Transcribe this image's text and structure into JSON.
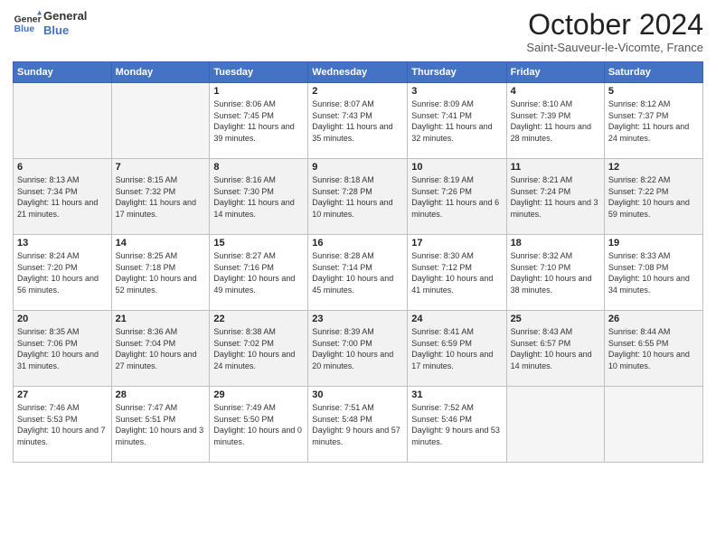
{
  "header": {
    "logo_line1": "General",
    "logo_line2": "Blue",
    "month": "October 2024",
    "location": "Saint-Sauveur-le-Vicomte, France"
  },
  "weekdays": [
    "Sunday",
    "Monday",
    "Tuesday",
    "Wednesday",
    "Thursday",
    "Friday",
    "Saturday"
  ],
  "weeks": [
    [
      {
        "day": "",
        "info": ""
      },
      {
        "day": "",
        "info": ""
      },
      {
        "day": "1",
        "info": "Sunrise: 8:06 AM\nSunset: 7:45 PM\nDaylight: 11 hours and 39 minutes."
      },
      {
        "day": "2",
        "info": "Sunrise: 8:07 AM\nSunset: 7:43 PM\nDaylight: 11 hours and 35 minutes."
      },
      {
        "day": "3",
        "info": "Sunrise: 8:09 AM\nSunset: 7:41 PM\nDaylight: 11 hours and 32 minutes."
      },
      {
        "day": "4",
        "info": "Sunrise: 8:10 AM\nSunset: 7:39 PM\nDaylight: 11 hours and 28 minutes."
      },
      {
        "day": "5",
        "info": "Sunrise: 8:12 AM\nSunset: 7:37 PM\nDaylight: 11 hours and 24 minutes."
      }
    ],
    [
      {
        "day": "6",
        "info": "Sunrise: 8:13 AM\nSunset: 7:34 PM\nDaylight: 11 hours and 21 minutes."
      },
      {
        "day": "7",
        "info": "Sunrise: 8:15 AM\nSunset: 7:32 PM\nDaylight: 11 hours and 17 minutes."
      },
      {
        "day": "8",
        "info": "Sunrise: 8:16 AM\nSunset: 7:30 PM\nDaylight: 11 hours and 14 minutes."
      },
      {
        "day": "9",
        "info": "Sunrise: 8:18 AM\nSunset: 7:28 PM\nDaylight: 11 hours and 10 minutes."
      },
      {
        "day": "10",
        "info": "Sunrise: 8:19 AM\nSunset: 7:26 PM\nDaylight: 11 hours and 6 minutes."
      },
      {
        "day": "11",
        "info": "Sunrise: 8:21 AM\nSunset: 7:24 PM\nDaylight: 11 hours and 3 minutes."
      },
      {
        "day": "12",
        "info": "Sunrise: 8:22 AM\nSunset: 7:22 PM\nDaylight: 10 hours and 59 minutes."
      }
    ],
    [
      {
        "day": "13",
        "info": "Sunrise: 8:24 AM\nSunset: 7:20 PM\nDaylight: 10 hours and 56 minutes."
      },
      {
        "day": "14",
        "info": "Sunrise: 8:25 AM\nSunset: 7:18 PM\nDaylight: 10 hours and 52 minutes."
      },
      {
        "day": "15",
        "info": "Sunrise: 8:27 AM\nSunset: 7:16 PM\nDaylight: 10 hours and 49 minutes."
      },
      {
        "day": "16",
        "info": "Sunrise: 8:28 AM\nSunset: 7:14 PM\nDaylight: 10 hours and 45 minutes."
      },
      {
        "day": "17",
        "info": "Sunrise: 8:30 AM\nSunset: 7:12 PM\nDaylight: 10 hours and 41 minutes."
      },
      {
        "day": "18",
        "info": "Sunrise: 8:32 AM\nSunset: 7:10 PM\nDaylight: 10 hours and 38 minutes."
      },
      {
        "day": "19",
        "info": "Sunrise: 8:33 AM\nSunset: 7:08 PM\nDaylight: 10 hours and 34 minutes."
      }
    ],
    [
      {
        "day": "20",
        "info": "Sunrise: 8:35 AM\nSunset: 7:06 PM\nDaylight: 10 hours and 31 minutes."
      },
      {
        "day": "21",
        "info": "Sunrise: 8:36 AM\nSunset: 7:04 PM\nDaylight: 10 hours and 27 minutes."
      },
      {
        "day": "22",
        "info": "Sunrise: 8:38 AM\nSunset: 7:02 PM\nDaylight: 10 hours and 24 minutes."
      },
      {
        "day": "23",
        "info": "Sunrise: 8:39 AM\nSunset: 7:00 PM\nDaylight: 10 hours and 20 minutes."
      },
      {
        "day": "24",
        "info": "Sunrise: 8:41 AM\nSunset: 6:59 PM\nDaylight: 10 hours and 17 minutes."
      },
      {
        "day": "25",
        "info": "Sunrise: 8:43 AM\nSunset: 6:57 PM\nDaylight: 10 hours and 14 minutes."
      },
      {
        "day": "26",
        "info": "Sunrise: 8:44 AM\nSunset: 6:55 PM\nDaylight: 10 hours and 10 minutes."
      }
    ],
    [
      {
        "day": "27",
        "info": "Sunrise: 7:46 AM\nSunset: 5:53 PM\nDaylight: 10 hours and 7 minutes."
      },
      {
        "day": "28",
        "info": "Sunrise: 7:47 AM\nSunset: 5:51 PM\nDaylight: 10 hours and 3 minutes."
      },
      {
        "day": "29",
        "info": "Sunrise: 7:49 AM\nSunset: 5:50 PM\nDaylight: 10 hours and 0 minutes."
      },
      {
        "day": "30",
        "info": "Sunrise: 7:51 AM\nSunset: 5:48 PM\nDaylight: 9 hours and 57 minutes."
      },
      {
        "day": "31",
        "info": "Sunrise: 7:52 AM\nSunset: 5:46 PM\nDaylight: 9 hours and 53 minutes."
      },
      {
        "day": "",
        "info": ""
      },
      {
        "day": "",
        "info": ""
      }
    ]
  ]
}
